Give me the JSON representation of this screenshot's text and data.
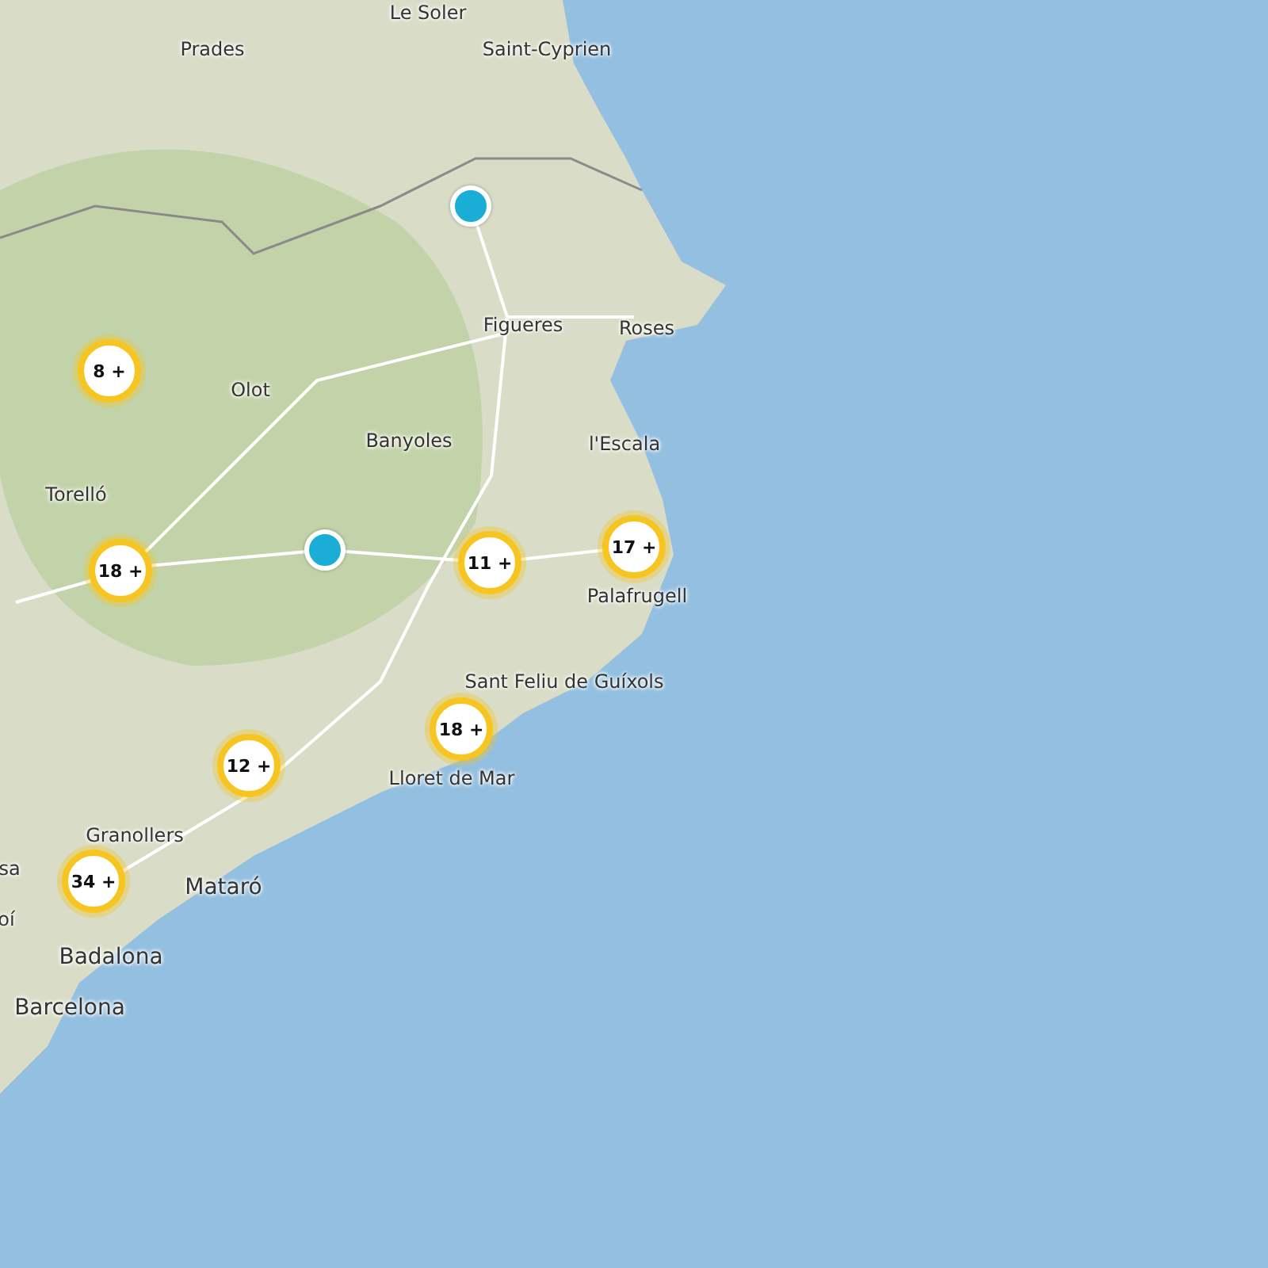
{
  "map": {
    "labels": [
      {
        "text": "Le Soler"
      },
      {
        "text": "Prades"
      },
      {
        "text": "Saint-Cyprien"
      },
      {
        "text": "Figueres"
      },
      {
        "text": "Roses"
      },
      {
        "text": "Olot"
      },
      {
        "text": "Banyoles"
      },
      {
        "text": "l'Escala"
      },
      {
        "text": "Torelló"
      },
      {
        "text": "Palafrugell"
      },
      {
        "text": "Sant Feliu de Guíxols"
      },
      {
        "text": "Lloret de Mar"
      },
      {
        "text": "Granollers"
      },
      {
        "text": "sa"
      },
      {
        "text": "Mataró"
      },
      {
        "text": "oí"
      },
      {
        "text": "Badalona"
      },
      {
        "text": "Barcelona"
      }
    ],
    "clusters": [
      {
        "count": "8 +"
      },
      {
        "count": "18 +"
      },
      {
        "count": "11 +"
      },
      {
        "count": "17 +"
      },
      {
        "count": "18 +"
      },
      {
        "count": "12 +"
      },
      {
        "count": "34 +"
      }
    ],
    "points": [
      {
        "kind": "single"
      },
      {
        "kind": "single"
      }
    ]
  }
}
